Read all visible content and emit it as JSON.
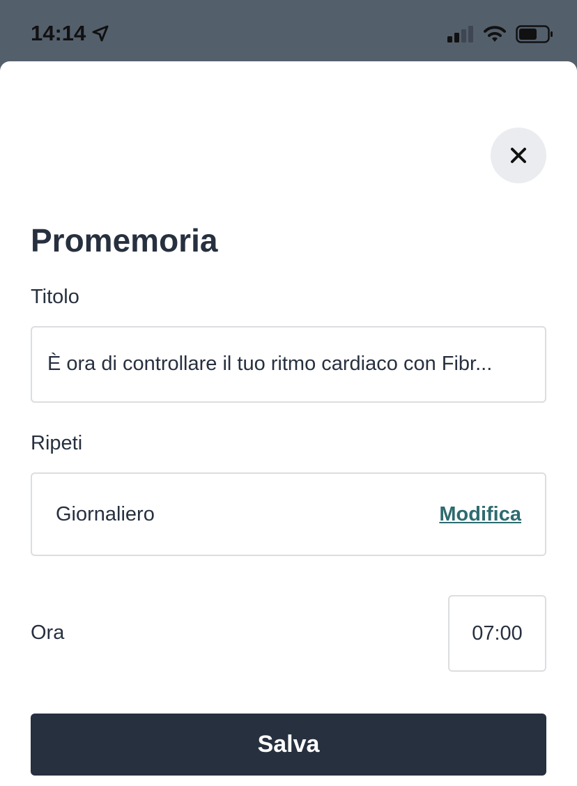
{
  "status_bar": {
    "time": "14:14",
    "icons": [
      "location-arrow-icon",
      "cellular-signal-icon",
      "wifi-icon",
      "battery-icon"
    ]
  },
  "sheet": {
    "close_icon": "close-icon",
    "title": "Promemoria",
    "title_field": {
      "label": "Titolo",
      "value": "È ora di controllare il tuo ritmo cardiaco con Fibr..."
    },
    "repeat_field": {
      "label": "Ripeti",
      "value": "Giornaliero",
      "edit_label": "Modifica"
    },
    "time_field": {
      "label": "Ora",
      "value": "07:00"
    },
    "save_label": "Salva"
  },
  "colors": {
    "status_bar_bg": "#545f6c",
    "text_dark": "#27303f",
    "link": "#2e6b6f",
    "button_bg": "#27303f",
    "border": "#dcdde0"
  }
}
